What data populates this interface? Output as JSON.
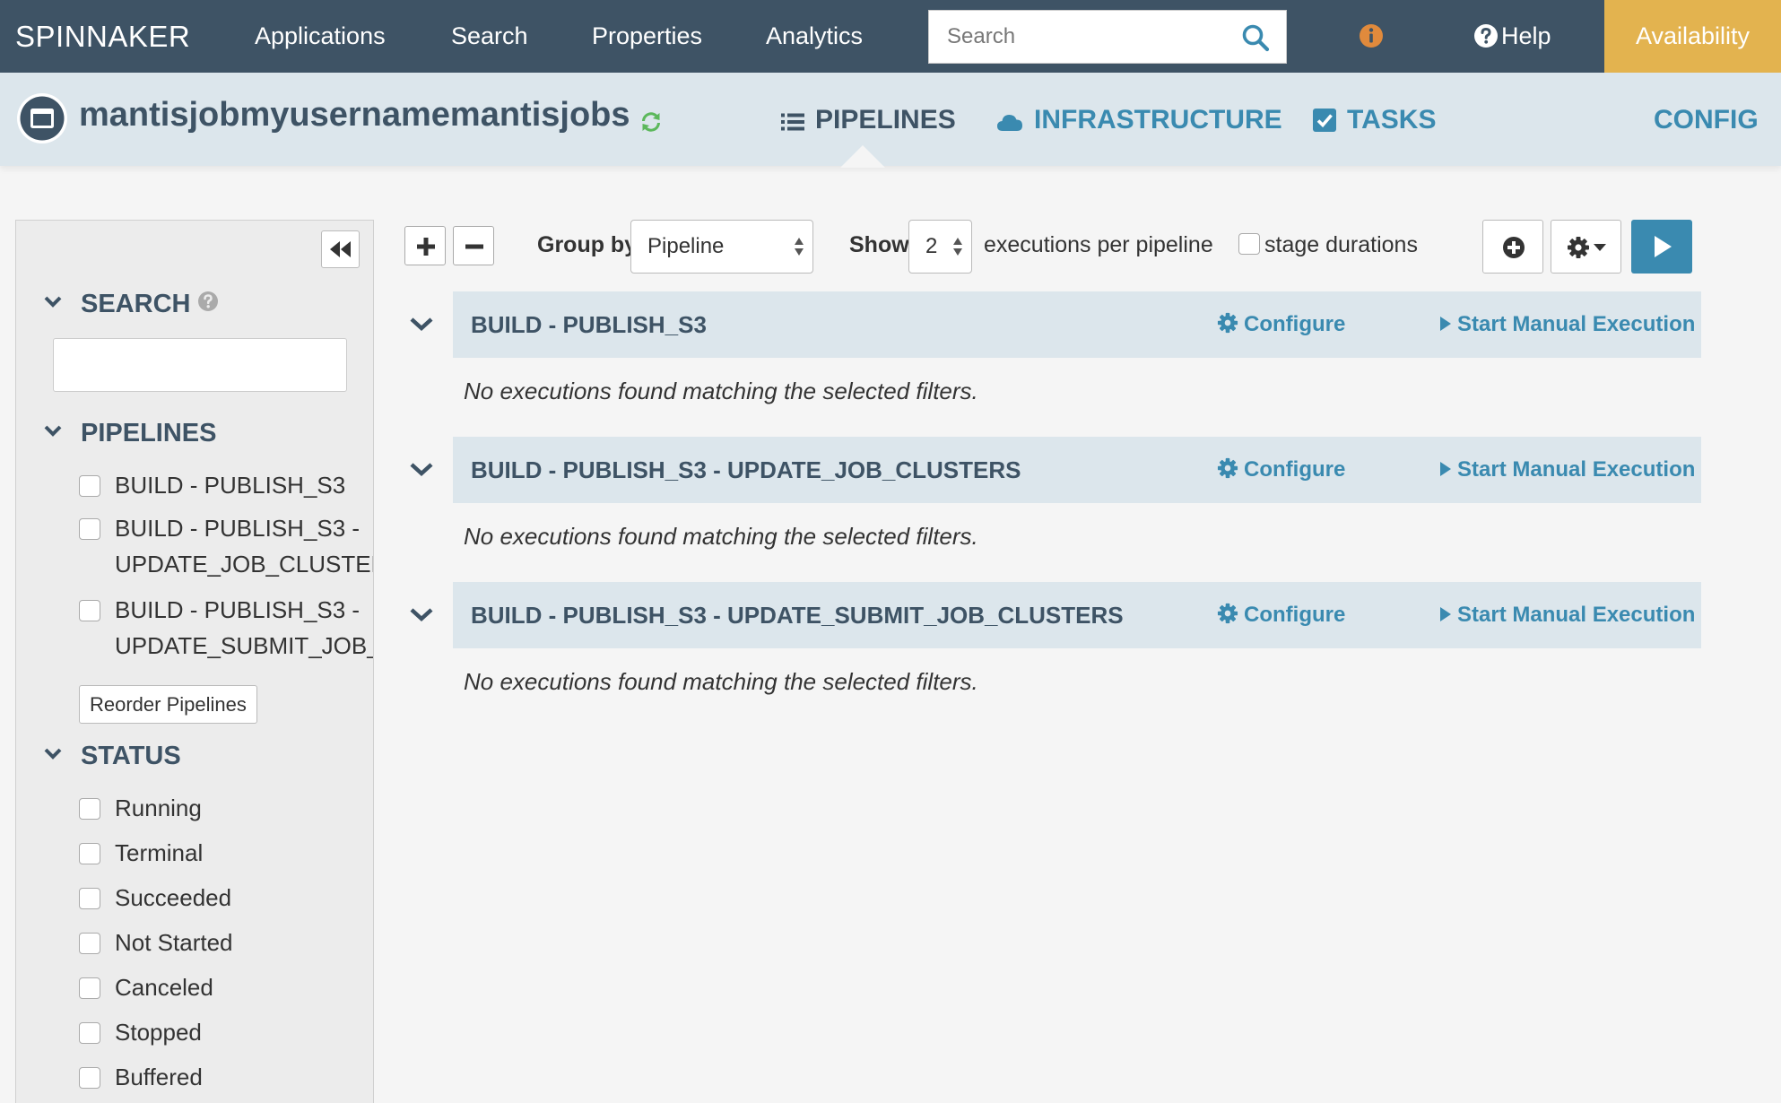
{
  "nav": {
    "brand": "SPINNAKER",
    "links": [
      "Applications",
      "Search",
      "Properties",
      "Analytics"
    ],
    "search_placeholder": "Search",
    "help_label": "Help",
    "availability_label": "Availability"
  },
  "app": {
    "name": "mantisjobmyusernamemantisjobs",
    "tabs": {
      "pipelines": "PIPELINES",
      "infrastructure": "INFRASTRUCTURE",
      "tasks": "TASKS",
      "config": "CONFIG"
    },
    "active_tab": "pipelines"
  },
  "sidebar": {
    "search_heading": "SEARCH",
    "search_value": "",
    "pipelines_heading": "PIPELINES",
    "pipelines": [
      {
        "line1": "BUILD - PUBLISH_S3",
        "line2": "",
        "checked": false
      },
      {
        "line1": "BUILD - PUBLISH_S3 -",
        "line2": "UPDATE_JOB_CLUSTERS",
        "checked": false
      },
      {
        "line1": "BUILD - PUBLISH_S3 -",
        "line2": "UPDATE_SUBMIT_JOB_C",
        "checked": false
      }
    ],
    "reorder_label": "Reorder Pipelines",
    "status_heading": "STATUS",
    "statuses": [
      {
        "label": "Running",
        "checked": false
      },
      {
        "label": "Terminal",
        "checked": false
      },
      {
        "label": "Succeeded",
        "checked": false
      },
      {
        "label": "Not Started",
        "checked": false
      },
      {
        "label": "Canceled",
        "checked": false
      },
      {
        "label": "Stopped",
        "checked": false
      },
      {
        "label": "Buffered",
        "checked": false
      }
    ]
  },
  "toolbar": {
    "group_by_label": "Group by",
    "group_by_value": "Pipeline",
    "show_label": "Show",
    "show_value": "2",
    "executions_label": "executions per pipeline",
    "stage_durations_label": "stage durations",
    "stage_durations_checked": false
  },
  "groups": [
    {
      "title": "BUILD - PUBLISH_S3",
      "configure": "Configure",
      "start": "Start Manual Execution",
      "empty": "No executions found matching the selected filters."
    },
    {
      "title": "BUILD - PUBLISH_S3 - UPDATE_JOB_CLUSTERS",
      "configure": "Configure",
      "start": "Start Manual Execution",
      "empty": "No executions found matching the selected filters."
    },
    {
      "title": "BUILD - PUBLISH_S3 - UPDATE_SUBMIT_JOB_CLUSTERS",
      "configure": "Configure",
      "start": "Start Manual Execution",
      "empty": "No executions found matching the selected filters."
    }
  ],
  "colors": {
    "nav_bg": "#3e5365",
    "accent": "#3a8ab0",
    "availability": "#e3b34f",
    "header_bg": "#dce6ec",
    "info_icon": "#e08a3c",
    "refresh_icon": "#5cb85c"
  },
  "icons": [
    "search-icon",
    "info-icon",
    "help-icon",
    "app-icon",
    "refresh-icon",
    "list-icon",
    "cloud-icon",
    "check-square-icon",
    "double-chevron-left-icon",
    "chevron-down-icon",
    "question-circle-icon",
    "plus-icon",
    "minus-icon",
    "plus-circle-icon",
    "gear-icon",
    "caret-down-icon",
    "play-icon"
  ]
}
